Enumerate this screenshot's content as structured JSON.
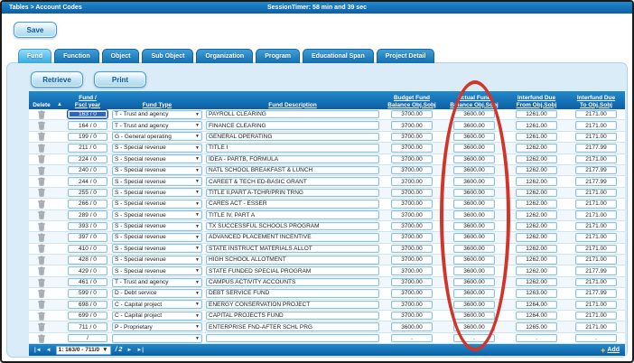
{
  "titlebar": {
    "breadcrumb": "Tables > Account Codes",
    "session_timer": "SessionTimer: 58 min and 39 sec"
  },
  "toolbar": {
    "save_label": "Save"
  },
  "tabs": [
    {
      "label": "Fund",
      "active": true
    },
    {
      "label": "Function",
      "active": false
    },
    {
      "label": "Object",
      "active": false
    },
    {
      "label": "Sub Object",
      "active": false
    },
    {
      "label": "Organization",
      "active": false
    },
    {
      "label": "Program",
      "active": false
    },
    {
      "label": "Educational Span",
      "active": false
    },
    {
      "label": "Project Detail",
      "active": false
    }
  ],
  "actions": {
    "retrieve_label": "Retrieve",
    "print_label": "Print"
  },
  "table": {
    "sort_icon": "▲",
    "columns": {
      "delete": "Delete",
      "fund_line1": "Fund /",
      "fund_line2": "Fscl year",
      "type": "Fund Type",
      "desc": "Fund Description",
      "budget_line1": "Budget Fund",
      "budget_line2": "Balance Obj.Sobj",
      "actual_line1": "Actual Fund",
      "actual_line2": "Balance Obj.Sobj",
      "from_line1": "Interfund Due",
      "from_line2": "From Obj.Sobj",
      "to_line1": "Interfund Due",
      "to_line2": "To Obj.Sobj"
    },
    "rows": [
      {
        "fund": "163 / 0",
        "type": "T - Trust and agency",
        "desc": "PAYROLL CLEARING",
        "budget": "3700.00",
        "actual": "3600.00",
        "due_from": "1261.00",
        "due_to": "2171.00",
        "selected": true
      },
      {
        "fund": "164 / 0",
        "type": "T - Trust and agency",
        "desc": "FINANCE CLEARING",
        "budget": "3700.00",
        "actual": "3600.00",
        "due_from": "1261.00",
        "due_to": "2171.00"
      },
      {
        "fund": "199 / 0",
        "type": "G - General operating",
        "desc": "GENERAL OPERATING",
        "budget": "3700.00",
        "actual": "3600.00",
        "due_from": "1261.00",
        "due_to": "2171.00"
      },
      {
        "fund": "211 / 0",
        "type": "S - Special revenue",
        "desc": "TITLE I",
        "budget": "3700.00",
        "actual": "3600.00",
        "due_from": "1262.00",
        "due_to": "2177.99"
      },
      {
        "fund": "224 / 0",
        "type": "S - Special revenue",
        "desc": "IDEA - PARTB, FORMULA",
        "budget": "3700.00",
        "actual": "3600.00",
        "due_from": "1262.00",
        "due_to": "2171.00"
      },
      {
        "fund": "240 / 0",
        "type": "S - Special revenue",
        "desc": "NATL SCHOOL BREAKFAST & LUNCH",
        "budget": "3700.00",
        "actual": "3600.00",
        "due_from": "1262.00",
        "due_to": "2177.99"
      },
      {
        "fund": "244 / 0",
        "type": "S - Special revenue",
        "desc": "CAREET & TECH ED-BASIC GRANT",
        "budget": "3700.00",
        "actual": "3600.00",
        "due_from": "1262.00",
        "due_to": "2177.99"
      },
      {
        "fund": "255 / 0",
        "type": "S - Special revenue",
        "desc": "TITLE II,PART A-TCHR/PRIN TRNG",
        "budget": "3700.00",
        "actual": "3600.00",
        "due_from": "1262.00",
        "due_to": "2171.00"
      },
      {
        "fund": "266 / 0",
        "type": "S - Special revenue",
        "desc": "CARES ACT - ESSER",
        "budget": "3700.00",
        "actual": "3600.00",
        "due_from": "1262.00",
        "due_to": "2171.00"
      },
      {
        "fund": "289 / 0",
        "type": "S - Special revenue",
        "desc": "TITLE IV, PART A",
        "budget": "3700.00",
        "actual": "3600.00",
        "due_from": "1262.00",
        "due_to": "2171.00"
      },
      {
        "fund": "393 / 0",
        "type": "S - Special revenue",
        "desc": "TX SUCCESSFUL SCHOOLS PROGRAM",
        "budget": "3700.00",
        "actual": "3600.00",
        "due_from": "1262.00",
        "due_to": "2171.00"
      },
      {
        "fund": "397 / 0",
        "type": "S - Special revenue",
        "desc": "ADVANCED PLACEMENT INCENTIVE",
        "budget": "3700.00",
        "actual": "3600.00",
        "due_from": "1262.00",
        "due_to": "2171.00"
      },
      {
        "fund": "410 / 0",
        "type": "S - Special revenue",
        "desc": "STATE INSTRUCT MATERIALS ALLOT",
        "budget": "3700.00",
        "actual": "3600.00",
        "due_from": "1262.00",
        "due_to": "2171.00"
      },
      {
        "fund": "428 / 0",
        "type": "S - Special revenue",
        "desc": "HIGH SCHOOL ALLOTMENT",
        "budget": "3700.00",
        "actual": "3600.00",
        "due_from": "1262.00",
        "due_to": "2171.00"
      },
      {
        "fund": "429 / 0",
        "type": "S - Special revenue",
        "desc": "STATE FUNDED SPECIAL PROGRAM",
        "budget": "3700.00",
        "actual": "3600.00",
        "due_from": "1262.00",
        "due_to": "2177.99"
      },
      {
        "fund": "461 / 0",
        "type": "T - Trust and agency",
        "desc": "CAMPUS ACTIVITY ACCOUNTS",
        "budget": "3700.00",
        "actual": "3600.00",
        "due_from": "1262.00",
        "due_to": "2171.00"
      },
      {
        "fund": "599 / 0",
        "type": "D - Debt service",
        "desc": "DEBT SERVICE FUND",
        "budget": "3700.00",
        "actual": "3600.00",
        "due_from": "1263.00",
        "due_to": "2177.99"
      },
      {
        "fund": "698 / 0",
        "type": "C - Capital project",
        "desc": "ENERGY CONSERVATION PROJECT",
        "budget": "3700.00",
        "actual": "3600.00",
        "due_from": "1264.00",
        "due_to": "2171.00"
      },
      {
        "fund": "699 / 0",
        "type": "C - Capital project",
        "desc": "CAPITAL PROJECTS FUND",
        "budget": "3700.00",
        "actual": "3600.00",
        "due_from": "1264.00",
        "due_to": "2171.00"
      },
      {
        "fund": "711 / 0",
        "type": "P - Proprietary",
        "desc": "ENTERPRISE FND-AFTER SCHL PRG",
        "budget": "3600.00",
        "actual": "3600.00",
        "due_from": "1265.00",
        "due_to": "2171.00"
      },
      {
        "fund": "/",
        "type": "",
        "desc": "",
        "budget": ".",
        "actual": ".",
        "due_from": ".",
        "due_to": "."
      }
    ]
  },
  "pagination": {
    "first_icon": "|◄",
    "prev_icon": "◄",
    "page_value": "1: 163/0 - 711/0",
    "select_arrow": "▼",
    "of_label": "/ 2",
    "next_icon": "►",
    "last_icon": "►|",
    "add_plus": "+",
    "add_label": "Add"
  },
  "annotation": {
    "shape": "ellipse",
    "color": "#d23527",
    "target": "actual-fund-balance-column"
  },
  "colors": {
    "bar_blue_top": "#2289cb",
    "bar_blue_bottom": "#0c5ea4",
    "panel_blue": "#d9ecf8",
    "selection_blue": "#3064bf",
    "annotation_red": "#d23527"
  }
}
